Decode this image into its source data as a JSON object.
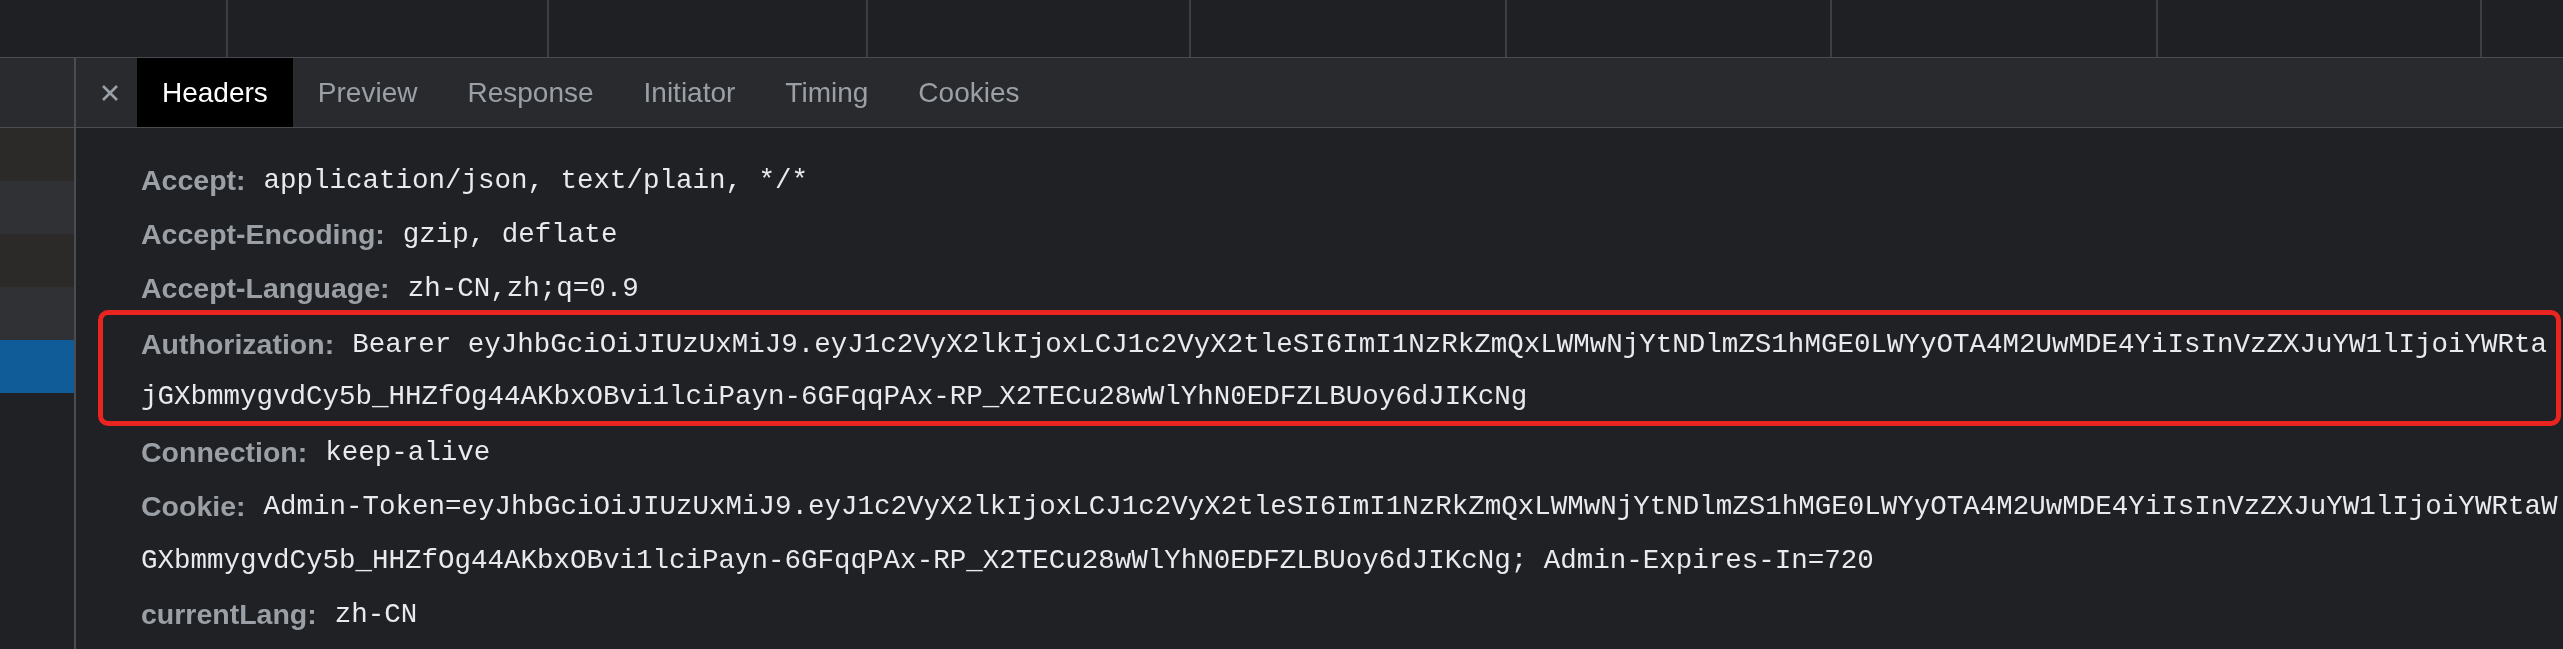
{
  "sidebar": {
    "rows": [
      {
        "selected": false
      },
      {
        "selected": false
      },
      {
        "selected": false
      },
      {
        "selected": false
      },
      {
        "selected": true
      }
    ]
  },
  "tabs": [
    {
      "label": "Headers",
      "selected": true
    },
    {
      "label": "Preview",
      "selected": false
    },
    {
      "label": "Response",
      "selected": false
    },
    {
      "label": "Initiator",
      "selected": false
    },
    {
      "label": "Timing",
      "selected": false
    },
    {
      "label": "Cookies",
      "selected": false
    }
  ],
  "headers": [
    {
      "name": "Accept:",
      "value_lines": [
        "application/json, text/plain, */*"
      ],
      "highlighted": false
    },
    {
      "name": "Accept-Encoding:",
      "value_lines": [
        "gzip, deflate"
      ],
      "highlighted": false
    },
    {
      "name": "Accept-Language:",
      "value_lines": [
        "zh-CN,zh;q=0.9"
      ],
      "highlighted": false
    },
    {
      "name": "Authorization:",
      "value_lines": [
        "Bearer eyJhbGciOiJIUzUxMiJ9.eyJ1c2VyX2lkIjoxLCJ1c2VyX2tleSI6ImI1NzRkZmQxLWMwNjYtNDlmZS1hMGE0LWYyOTA4M2UwMDE4YiIsInVzZXJuYW1lIjoiYWRta",
        "jGXbmmygvdCy5b_HHZfOg44AKbxOBvi1lciPayn-6GFqqPAx-RP_X2TECu28wWlYhN0EDFZLBUoy6dJIKcNg"
      ],
      "highlighted": true
    },
    {
      "name": "Connection:",
      "value_lines": [
        "keep-alive"
      ],
      "highlighted": false
    },
    {
      "name": "Cookie:",
      "value_lines": [
        "Admin-Token=eyJhbGciOiJIUzUxMiJ9.eyJ1c2VyX2lkIjoxLCJ1c2VyX2tleSI6ImI1NzRkZmQxLWMwNjYtNDlmZS1hMGE0LWYyOTA4M2UwMDE4YiIsInVzZXJuYW1lIjoiYWRtaW",
        "GXbmmygvdCy5b_HHZfOg44AKbxOBvi1lciPayn-6GFqqPAx-RP_X2TECu28wWlYhN0EDFZLBUoy6dJIKcNg; Admin-Expires-In=720"
      ],
      "highlighted": false
    },
    {
      "name": "currentLang:",
      "value_lines": [
        "zh-CN"
      ],
      "highlighted": false
    }
  ]
}
